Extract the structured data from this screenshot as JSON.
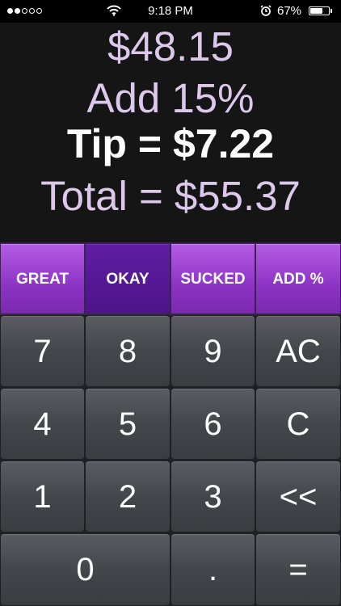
{
  "status_bar": {
    "signal_full": 2,
    "signal_empty": 3,
    "time": "9:18 PM",
    "battery_percent": "67%",
    "battery_level": 0.67,
    "icons": [
      "wifi-icon",
      "alarm-icon",
      "battery-icon"
    ]
  },
  "display": {
    "bill": "$48.15",
    "add_percent": "Add 15%",
    "tip": "Tip = $7.22",
    "total": "Total = $55.37"
  },
  "rating": {
    "selected": "OKAY",
    "buttons": [
      "GREAT",
      "OKAY",
      "SUCKED",
      "ADD %"
    ]
  },
  "keypad": {
    "rows": [
      [
        "7",
        "8",
        "9",
        "AC"
      ],
      [
        "4",
        "5",
        "6",
        "C"
      ],
      [
        "1",
        "2",
        "3",
        "<<"
      ],
      [
        "0",
        ".",
        "="
      ]
    ]
  },
  "colors": {
    "display_text": "#ddc8ec",
    "tip_text": "#ffffff",
    "rating_button": "#8c33c4",
    "rating_selected": "#4d1488",
    "key": "#44464b"
  }
}
